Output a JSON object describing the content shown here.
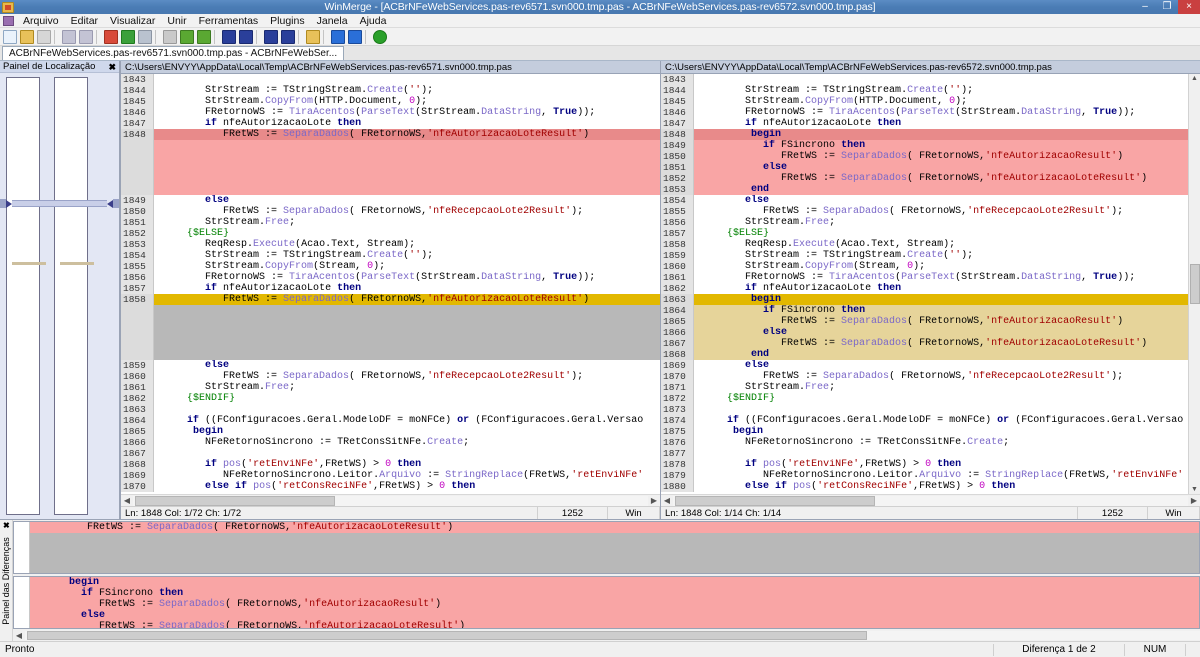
{
  "window": {
    "title": "WinMerge - [ACBrNFeWebServices.pas-rev6571.svn000.tmp.pas - ACBrNFeWebServices.pas-rev6572.svn000.tmp.pas]",
    "minimize": "–",
    "maximize": "❐",
    "close": "×"
  },
  "menu": {
    "items": [
      "Arquivo",
      "Editar",
      "Visualizar",
      "Unir",
      "Ferramentas",
      "Plugins",
      "Janela",
      "Ajuda"
    ]
  },
  "toolbar": {
    "buttons": [
      {
        "name": "new-file-icon",
        "color": "#dfeaf7"
      },
      {
        "name": "open-file-icon",
        "color": "#e8c15a"
      },
      {
        "name": "save-file-icon",
        "color": "#cfcfcf"
      },
      {
        "name": "undo-icon",
        "color": "#b8b8c8"
      },
      {
        "name": "redo-icon",
        "color": "#b8b8c8"
      },
      {
        "name": "refresh-icon",
        "color": "#d84a3a"
      },
      {
        "name": "copy-right-icon",
        "color": "#3aa03a"
      },
      {
        "name": "copy-left-icon",
        "color": "#9aa3b5"
      },
      {
        "name": "first-diff-icon",
        "color": "#b8b8b8"
      },
      {
        "name": "previous-diff-icon",
        "color": "#3aa03a"
      },
      {
        "name": "next-diff-icon",
        "color": "#3aa03a"
      },
      {
        "name": "merge-right-icon",
        "color": "#2a3f9a"
      },
      {
        "name": "merge-left-icon",
        "color": "#2a3f9a"
      },
      {
        "name": "copy-right-all-icon",
        "color": "#2a3f9a"
      },
      {
        "name": "copy-left-all-icon",
        "color": "#2a3f9a"
      },
      {
        "name": "edit-icon",
        "color": "#e8c15a"
      },
      {
        "name": "play-icon",
        "color": "#2a6fd8"
      },
      {
        "name": "options-icon",
        "color": "#2a6fd8"
      },
      {
        "name": "help-icon",
        "color": "#2aa02a"
      }
    ]
  },
  "tab": {
    "label": "ACBrNFeWebServices.pas-rev6571.svn000.tmp.pas - ACBrNFeWebSer..."
  },
  "location_panel": {
    "title": "Painel de Localização",
    "close": "✖"
  },
  "left_pane": {
    "header": "C:\\Users\\ENVYY\\AppData\\Local\\Temp\\ACBrNFeWebServices.pas-rev6571.svn000.tmp.pas",
    "status": {
      "position": "Ln: 1848 Col: 1/72 Ch: 1/72",
      "codepage": "1252",
      "eol": "Win"
    },
    "lines": [
      {
        "n": "1843",
        "t": "",
        "d": "none"
      },
      {
        "n": "1844",
        "t": "        StrStream := TStringStream.Create('');",
        "d": "none"
      },
      {
        "n": "1845",
        "t": "        StrStream.CopyFrom(HTTP.Document, 0);",
        "d": "none"
      },
      {
        "n": "1846",
        "t": "        FRetornoWS := TiraAcentos(ParseText(StrStream.DataString, True));",
        "d": "none"
      },
      {
        "n": "1847",
        "t": "        if nfeAutorizacaoLote then",
        "d": "none"
      },
      {
        "n": "1848",
        "t": "           FRetWS := SeparaDados( FRetornoWS,'nfeAutorizacaoLoteResult')",
        "d": "redsel"
      },
      {
        "n": "",
        "t": "",
        "d": "red"
      },
      {
        "n": "",
        "t": "",
        "d": "red"
      },
      {
        "n": "",
        "t": "",
        "d": "red"
      },
      {
        "n": "",
        "t": "",
        "d": "red"
      },
      {
        "n": "",
        "t": "",
        "d": "red"
      },
      {
        "n": "1849",
        "t": "        else",
        "d": "none"
      },
      {
        "n": "1850",
        "t": "           FRetWS := SeparaDados( FRetornoWS,'nfeRecepcaoLote2Result');",
        "d": "none"
      },
      {
        "n": "1851",
        "t": "        StrStream.Free;",
        "d": "none"
      },
      {
        "n": "1852",
        "t": "     {$ELSE}",
        "d": "none"
      },
      {
        "n": "1853",
        "t": "        ReqResp.Execute(Acao.Text, Stream);",
        "d": "none"
      },
      {
        "n": "1854",
        "t": "        StrStream := TStringStream.Create('');",
        "d": "none"
      },
      {
        "n": "1855",
        "t": "        StrStream.CopyFrom(Stream, 0);",
        "d": "none"
      },
      {
        "n": "1856",
        "t": "        FRetornoWS := TiraAcentos(ParseText(StrStream.DataString, True));",
        "d": "none"
      },
      {
        "n": "1857",
        "t": "        if nfeAutorizacaoLote then",
        "d": "none"
      },
      {
        "n": "1858",
        "t": "           FRetWS := SeparaDados( FRetornoWS,'nfeAutorizacaoLoteResult')",
        "d": "yelsel"
      },
      {
        "n": "",
        "t": "",
        "d": "grey"
      },
      {
        "n": "",
        "t": "",
        "d": "grey"
      },
      {
        "n": "",
        "t": "",
        "d": "grey"
      },
      {
        "n": "",
        "t": "",
        "d": "grey"
      },
      {
        "n": "",
        "t": "",
        "d": "grey"
      },
      {
        "n": "1859",
        "t": "        else",
        "d": "none"
      },
      {
        "n": "1860",
        "t": "           FRetWS := SeparaDados( FRetornoWS,'nfeRecepcaoLote2Result');",
        "d": "none"
      },
      {
        "n": "1861",
        "t": "        StrStream.Free;",
        "d": "none"
      },
      {
        "n": "1862",
        "t": "     {$ENDIF}",
        "d": "none"
      },
      {
        "n": "1863",
        "t": "",
        "d": "none"
      },
      {
        "n": "1864",
        "t": "     if ((FConfiguracoes.Geral.ModeloDF = moNFCe) or (FConfiguracoes.Geral.Versao",
        "d": "none"
      },
      {
        "n": "1865",
        "t": "      begin",
        "d": "none"
      },
      {
        "n": "1866",
        "t": "        NFeRetornoSincrono := TRetConsSitNFe.Create;",
        "d": "none"
      },
      {
        "n": "1867",
        "t": "",
        "d": "none"
      },
      {
        "n": "1868",
        "t": "        if pos('retEnviNFe',FRetWS) > 0 then",
        "d": "none"
      },
      {
        "n": "1869",
        "t": "           NFeRetornoSincrono.Leitor.Arquivo := StringReplace(FRetWS,'retEnviNFe'",
        "d": "none"
      },
      {
        "n": "1870",
        "t": "        else if pos('retConsReciNFe',FRetWS) > 0 then",
        "d": "none"
      }
    ]
  },
  "right_pane": {
    "header": "C:\\Users\\ENVYY\\AppData\\Local\\Temp\\ACBrNFeWebServices.pas-rev6572.svn000.tmp.pas",
    "status": {
      "position": "Ln: 1848 Col: 1/14 Ch: 1/14",
      "codepage": "1252",
      "eol": "Win"
    },
    "lines": [
      {
        "n": "1843",
        "t": "",
        "d": "none"
      },
      {
        "n": "1844",
        "t": "        StrStream := TStringStream.Create('');",
        "d": "none"
      },
      {
        "n": "1845",
        "t": "        StrStream.CopyFrom(HTTP.Document, 0);",
        "d": "none"
      },
      {
        "n": "1846",
        "t": "        FRetornoWS := TiraAcentos(ParseText(StrStream.DataString, True));",
        "d": "none"
      },
      {
        "n": "1847",
        "t": "        if nfeAutorizacaoLote then",
        "d": "none"
      },
      {
        "n": "1848",
        "t": "         begin",
        "d": "redsel"
      },
      {
        "n": "1849",
        "t": "           if FSincrono then",
        "d": "red"
      },
      {
        "n": "1850",
        "t": "              FRetWS := SeparaDados( FRetornoWS,'nfeAutorizacaoResult')",
        "d": "red"
      },
      {
        "n": "1851",
        "t": "           else",
        "d": "red"
      },
      {
        "n": "1852",
        "t": "              FRetWS := SeparaDados( FRetornoWS,'nfeAutorizacaoLoteResult')",
        "d": "red"
      },
      {
        "n": "1853",
        "t": "         end",
        "d": "red"
      },
      {
        "n": "1854",
        "t": "        else",
        "d": "none"
      },
      {
        "n": "1855",
        "t": "           FRetWS := SeparaDados( FRetornoWS,'nfeRecepcaoLote2Result');",
        "d": "none"
      },
      {
        "n": "1856",
        "t": "        StrStream.Free;",
        "d": "none"
      },
      {
        "n": "1857",
        "t": "     {$ELSE}",
        "d": "none"
      },
      {
        "n": "1858",
        "t": "        ReqResp.Execute(Acao.Text, Stream);",
        "d": "none"
      },
      {
        "n": "1859",
        "t": "        StrStream := TStringStream.Create('');",
        "d": "none"
      },
      {
        "n": "1860",
        "t": "        StrStream.CopyFrom(Stream, 0);",
        "d": "none"
      },
      {
        "n": "1861",
        "t": "        FRetornoWS := TiraAcentos(ParseText(StrStream.DataString, True));",
        "d": "none"
      },
      {
        "n": "1862",
        "t": "        if nfeAutorizacaoLote then",
        "d": "none"
      },
      {
        "n": "1863",
        "t": "         begin",
        "d": "yelsel"
      },
      {
        "n": "1864",
        "t": "           if FSincrono then",
        "d": "yel"
      },
      {
        "n": "1865",
        "t": "              FRetWS := SeparaDados( FRetornoWS,'nfeAutorizacaoResult')",
        "d": "yel"
      },
      {
        "n": "1866",
        "t": "           else",
        "d": "yel"
      },
      {
        "n": "1867",
        "t": "              FRetWS := SeparaDados( FRetornoWS,'nfeAutorizacaoLoteResult')",
        "d": "yel"
      },
      {
        "n": "1868",
        "t": "         end",
        "d": "yel"
      },
      {
        "n": "1869",
        "t": "        else",
        "d": "none"
      },
      {
        "n": "1870",
        "t": "           FRetWS := SeparaDados( FRetornoWS,'nfeRecepcaoLote2Result');",
        "d": "none"
      },
      {
        "n": "1871",
        "t": "        StrStream.Free;",
        "d": "none"
      },
      {
        "n": "1872",
        "t": "     {$ENDIF}",
        "d": "none"
      },
      {
        "n": "1873",
        "t": "",
        "d": "none"
      },
      {
        "n": "1874",
        "t": "     if ((FConfiguracoes.Geral.ModeloDF = moNFCe) or (FConfiguracoes.Geral.Versao",
        "d": "none"
      },
      {
        "n": "1875",
        "t": "      begin",
        "d": "none"
      },
      {
        "n": "1876",
        "t": "        NFeRetornoSincrono := TRetConsSitNFe.Create;",
        "d": "none"
      },
      {
        "n": "1877",
        "t": "",
        "d": "none"
      },
      {
        "n": "1878",
        "t": "        if pos('retEnviNFe',FRetWS) > 0 then",
        "d": "none"
      },
      {
        "n": "1879",
        "t": "           NFeRetornoSincrono.Leitor.Arquivo := StringReplace(FRetWS,'retEnviNFe'",
        "d": "none"
      },
      {
        "n": "1880",
        "t": "        else if pos('retConsReciNFe',FRetWS) > 0 then",
        "d": "none"
      }
    ]
  },
  "diff_panel": {
    "title": "Painel das Diferenças",
    "close": "✖",
    "top_lines": [
      {
        "t": "         FRetWS := SeparaDados( FRetornoWS,'nfeAutorizacaoLoteResult')",
        "d": "red"
      },
      {
        "t": "",
        "d": "grey"
      },
      {
        "t": "",
        "d": "grey"
      },
      {
        "t": "",
        "d": "grey"
      },
      {
        "t": "",
        "d": "grey"
      }
    ],
    "bottom_lines": [
      {
        "t": "      begin",
        "d": "red"
      },
      {
        "t": "        if FSincrono then",
        "d": "red"
      },
      {
        "t": "           FRetWS := SeparaDados( FRetornoWS,'nfeAutorizacaoResult')",
        "d": "red"
      },
      {
        "t": "        else",
        "d": "red"
      },
      {
        "t": "           FRetWS := SeparaDados( FRetornoWS,'nfeAutorizacaoLoteResult')",
        "d": "red"
      }
    ]
  },
  "statusbar": {
    "ready": "Pronto",
    "difference": "Diferença 1 de 2",
    "num": "NUM"
  },
  "colors": {
    "diff_red": "#f9a5a5",
    "diff_red_selected": "#e88a8a",
    "diff_yellow": "#e6d49a",
    "diff_yellow_selected": "#e2b800",
    "diff_grey": "#b8b8b8",
    "title_bar": "#4a7cb5",
    "pane_header": "#c4cddd"
  }
}
